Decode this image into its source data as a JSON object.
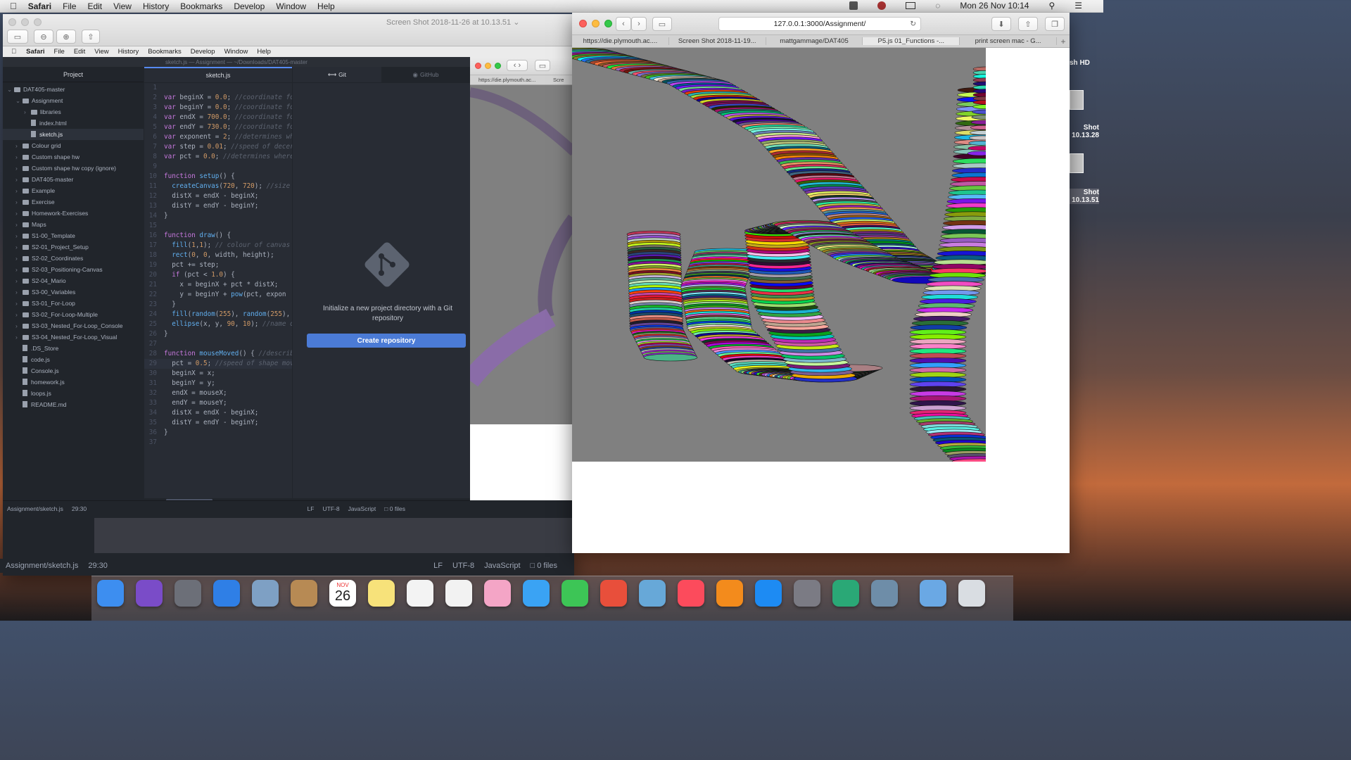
{
  "menubar": {
    "apple": "",
    "app": "Safari",
    "items": [
      "File",
      "Edit",
      "View",
      "History",
      "Bookmarks",
      "Develop",
      "Window",
      "Help"
    ],
    "clock": "Mon 26 Nov  10:14"
  },
  "preview": {
    "title": "Screen Shot 2018-11-26 at 10.13.51"
  },
  "inner_menubar": {
    "app": "Safari",
    "items": [
      "File",
      "Edit",
      "View",
      "History",
      "Bookmarks",
      "Develop",
      "Window",
      "Help"
    ]
  },
  "atom": {
    "title": "sketch.js — Assignment — ~/Downloads/DAT405-master",
    "project_tab": "Project",
    "editor_tab": "sketch.js",
    "git_tab": "Git",
    "github_tab": "GitHub",
    "tree": [
      {
        "d": 0,
        "t": "folder",
        "open": true,
        "label": "DAT405-master"
      },
      {
        "d": 1,
        "t": "folder",
        "open": true,
        "label": "Assignment"
      },
      {
        "d": 2,
        "t": "folder",
        "open": false,
        "label": "libraries"
      },
      {
        "d": 2,
        "t": "file",
        "label": "index.html"
      },
      {
        "d": 2,
        "t": "file",
        "label": "sketch.js",
        "selected": true
      },
      {
        "d": 1,
        "t": "folder",
        "label": "Colour grid"
      },
      {
        "d": 1,
        "t": "folder",
        "label": "Custom shape hw"
      },
      {
        "d": 1,
        "t": "folder",
        "label": "Custom shape hw copy (ignore)"
      },
      {
        "d": 1,
        "t": "folder",
        "label": "DAT405-master"
      },
      {
        "d": 1,
        "t": "folder",
        "label": "Example"
      },
      {
        "d": 1,
        "t": "folder",
        "label": "Exercise"
      },
      {
        "d": 1,
        "t": "folder",
        "label": "Homework-Exercises"
      },
      {
        "d": 1,
        "t": "folder",
        "label": "Maps"
      },
      {
        "d": 1,
        "t": "folder",
        "label": "S1-00_Template"
      },
      {
        "d": 1,
        "t": "folder",
        "label": "S2-01_Project_Setup"
      },
      {
        "d": 1,
        "t": "folder",
        "label": "S2-02_Coordinates"
      },
      {
        "d": 1,
        "t": "folder",
        "label": "S2-03_Positioning-Canvas"
      },
      {
        "d": 1,
        "t": "folder",
        "label": "S2-04_Mario"
      },
      {
        "d": 1,
        "t": "folder",
        "label": "S3-00_Variables"
      },
      {
        "d": 1,
        "t": "folder",
        "label": "S3-01_For-Loop"
      },
      {
        "d": 1,
        "t": "folder",
        "label": "S3-02_For-Loop-Multiple"
      },
      {
        "d": 1,
        "t": "folder",
        "label": "S3-03_Nested_For-Loop_Console"
      },
      {
        "d": 1,
        "t": "folder",
        "label": "S3-04_Nested_For-Loop_Visual"
      },
      {
        "d": 1,
        "t": "file",
        "label": ".DS_Store"
      },
      {
        "d": 1,
        "t": "file",
        "label": "code.js"
      },
      {
        "d": 1,
        "t": "file",
        "label": "Console.js"
      },
      {
        "d": 1,
        "t": "file",
        "label": "homework.js"
      },
      {
        "d": 1,
        "t": "file",
        "label": "loops.js"
      },
      {
        "d": 1,
        "t": "file",
        "label": "README.md"
      }
    ],
    "code": [
      [],
      [
        [
          "kw",
          "var "
        ],
        [
          "",
          "beginX = "
        ],
        [
          "num",
          "0.0"
        ],
        [
          "",
          "; "
        ],
        [
          "cm",
          "//coordinate fo"
        ]
      ],
      [
        [
          "kw",
          "var "
        ],
        [
          "",
          "beginY = "
        ],
        [
          "num",
          "0.0"
        ],
        [
          "",
          "; "
        ],
        [
          "cm",
          "//coordinate fo"
        ]
      ],
      [
        [
          "kw",
          "var "
        ],
        [
          "",
          "endX = "
        ],
        [
          "num",
          "700.0"
        ],
        [
          "",
          "; "
        ],
        [
          "cm",
          "//coordinate fo"
        ]
      ],
      [
        [
          "kw",
          "var "
        ],
        [
          "",
          "endY = "
        ],
        [
          "num",
          "730.0"
        ],
        [
          "",
          "; "
        ],
        [
          "cm",
          "//coordinate fo"
        ]
      ],
      [
        [
          "kw",
          "var "
        ],
        [
          "",
          "exponent = "
        ],
        [
          "num",
          "2"
        ],
        [
          "",
          "; "
        ],
        [
          "cm",
          "//determines wh"
        ]
      ],
      [
        [
          "kw",
          "var "
        ],
        [
          "",
          "step = "
        ],
        [
          "num",
          "0.01"
        ],
        [
          "",
          "; "
        ],
        [
          "cm",
          "//speed of decer"
        ]
      ],
      [
        [
          "kw",
          "var "
        ],
        [
          "",
          "pct = "
        ],
        [
          "num",
          "0.0"
        ],
        [
          "",
          "; "
        ],
        [
          "cm",
          "//determines where"
        ]
      ],
      [],
      [
        [
          "kw",
          "function "
        ],
        [
          "fn",
          "setup"
        ],
        [
          "",
          "() {"
        ]
      ],
      [
        [
          "",
          "  "
        ],
        [
          "fn",
          "createCanvas"
        ],
        [
          "",
          "("
        ],
        [
          "num",
          "720"
        ],
        [
          "",
          ", "
        ],
        [
          "num",
          "720"
        ],
        [
          "",
          "); "
        ],
        [
          "cm",
          "//size"
        ]
      ],
      [
        [
          "",
          "  distX = endX - beginX;"
        ]
      ],
      [
        [
          "",
          "  distY = endY - beginY;"
        ]
      ],
      [
        [
          "",
          "}"
        ]
      ],
      [],
      [
        [
          "kw",
          "function "
        ],
        [
          "fn",
          "draw"
        ],
        [
          "",
          "() {"
        ]
      ],
      [
        [
          "",
          "  "
        ],
        [
          "fn",
          "fill"
        ],
        [
          "",
          "("
        ],
        [
          "num",
          "1"
        ],
        [
          "",
          ","
        ],
        [
          "num",
          "1"
        ],
        [
          "",
          "); "
        ],
        [
          "cm",
          "// colour of canvas"
        ]
      ],
      [
        [
          "",
          "  "
        ],
        [
          "fn",
          "rect"
        ],
        [
          "",
          "("
        ],
        [
          "num",
          "0"
        ],
        [
          "",
          ", "
        ],
        [
          "num",
          "0"
        ],
        [
          "",
          ", width, height);"
        ]
      ],
      [
        [
          "",
          "  pct += step;"
        ]
      ],
      [
        [
          "",
          "  "
        ],
        [
          "kw",
          "if "
        ],
        [
          "",
          "(pct < "
        ],
        [
          "num",
          "1.0"
        ],
        [
          "",
          ") {"
        ]
      ],
      [
        [
          "",
          "    x = beginX + pct * distX;"
        ]
      ],
      [
        [
          "",
          "    y = beginY + "
        ],
        [
          "fn",
          "pow"
        ],
        [
          "",
          "(pct, expon"
        ]
      ],
      [
        [
          "",
          "  }"
        ]
      ],
      [
        [
          "",
          "  "
        ],
        [
          "fn",
          "fill"
        ],
        [
          "",
          "("
        ],
        [
          "fn",
          "random"
        ],
        [
          "",
          "("
        ],
        [
          "num",
          "255"
        ],
        [
          "",
          "), "
        ],
        [
          "fn",
          "random"
        ],
        [
          "",
          "("
        ],
        [
          "num",
          "255"
        ],
        [
          "",
          "),"
        ]
      ],
      [
        [
          "",
          "  "
        ],
        [
          "fn",
          "ellipse"
        ],
        [
          "",
          "(x, y, "
        ],
        [
          "num",
          "90"
        ],
        [
          "",
          ", "
        ],
        [
          "num",
          "10"
        ],
        [
          "",
          "); "
        ],
        [
          "cm",
          "//name o"
        ]
      ],
      [
        [
          "",
          "}"
        ]
      ],
      [],
      [
        [
          "kw",
          "function "
        ],
        [
          "fn",
          "mouseMoved"
        ],
        [
          "",
          "() { "
        ],
        [
          "cm",
          "//describ"
        ]
      ],
      [
        [
          "",
          "  pct = "
        ],
        [
          "num",
          "0.5"
        ],
        [
          "",
          "; "
        ],
        [
          "cm",
          "//speed of shape mov"
        ]
      ],
      [
        [
          "",
          "  beginX = x;"
        ]
      ],
      [
        [
          "",
          "  beginY = y;"
        ]
      ],
      [
        [
          "",
          "  endX = mouseX;"
        ]
      ],
      [
        [
          "",
          "  endY = mouseY;"
        ]
      ],
      [
        [
          "",
          "  distX = endX - beginX;"
        ]
      ],
      [
        [
          "",
          "  distY = endY - beginY;"
        ]
      ],
      [
        [
          "",
          "}"
        ]
      ],
      []
    ],
    "git": {
      "message": "Initialize a new project directory with a Git repository",
      "button": "Create repository"
    },
    "status": {
      "file": "Assignment/sketch.js",
      "pos": "29:30",
      "eol": "LF",
      "enc": "UTF-8",
      "lang": "JavaScript",
      "files": "0 files"
    }
  },
  "outer_status": {
    "file": "Assignment/sketch.js",
    "pos": "29:30",
    "eol": "LF",
    "enc": "UTF-8",
    "lang": "JavaScript",
    "files": "0 files"
  },
  "mid_safari": {
    "tab": "https://die.plymouth.ac...",
    "tab2": "Scre"
  },
  "safari": {
    "url": "127.0.0.1:3000/Assignment/",
    "tabs": [
      "https://die.plymouth.ac....",
      "Screen Shot 2018-11-19...",
      "mattgammage/DAT405",
      "P5.js 01_Functions -...",
      "print screen mac - G..."
    ],
    "active_tab": 3
  },
  "desktop": {
    "hd": "sh HD",
    "shot1": "Shot",
    "shot1b": "10.13.28",
    "shot2": "Shot",
    "shot2b": "10.13.51"
  },
  "dock": {
    "cal_month": "NOV",
    "cal_day": "26"
  },
  "colors": {
    "atom_bg": "#21252b",
    "editor_bg": "#282c34",
    "git_button": "#4b7bd6",
    "canvas": "#808080"
  }
}
